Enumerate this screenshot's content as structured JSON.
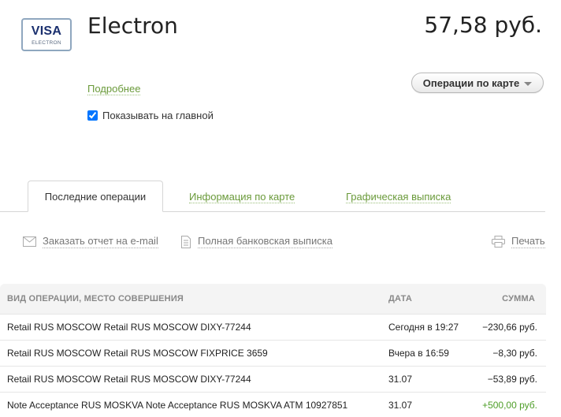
{
  "card": {
    "logo_brand": "VISA",
    "logo_sub": "ELECTRON",
    "title": "Electron",
    "balance": "57,58 руб."
  },
  "links": {
    "more": "Подробнее"
  },
  "operations_button": {
    "label": "Операции по карте"
  },
  "show_on_main": {
    "label": "Показывать на главной",
    "checked": true
  },
  "tabs": [
    {
      "label": "Последние операции",
      "active": true
    },
    {
      "label": "Информация по карте",
      "active": false
    },
    {
      "label": "Графическая выписка",
      "active": false
    }
  ],
  "actions": {
    "email_report": {
      "label": "Заказать отчет на e-mail",
      "icon": "envelope-icon"
    },
    "full_statement": {
      "label": "Полная банковская выписка",
      "icon": "document-icon"
    },
    "print": {
      "label": "Печать",
      "icon": "printer-icon"
    }
  },
  "table": {
    "headers": [
      "ВИД ОПЕРАЦИИ, МЕСТО СОВЕРШЕНИЯ",
      "ДАТА",
      "СУММА"
    ],
    "rows": [
      {
        "description": "Retail RUS MOSCOW Retail RUS MOSCOW DIXY-77244",
        "date": "Сегодня в 19:27",
        "amount": "−230,66 руб.",
        "type": "debit"
      },
      {
        "description": "Retail RUS MOSCOW Retail RUS MOSCOW FIXPRICE 3659",
        "date": "Вчера в 16:59",
        "amount": "−8,30 руб.",
        "type": "debit"
      },
      {
        "description": "Retail RUS MOSCOW Retail RUS MOSCOW DIXY-77244",
        "date": "31.07",
        "amount": "−53,89 руб.",
        "type": "debit"
      },
      {
        "description": "Note Acceptance RUS MOSKVA Note Acceptance RUS MOSKVA ATM 10927851",
        "date": "31.07",
        "amount": "+500,00 руб.",
        "type": "credit"
      }
    ]
  },
  "colors": {
    "link_green": "#6a9a3a",
    "credit_green": "#4e9e28",
    "visa_blue": "#1a2f6e"
  }
}
